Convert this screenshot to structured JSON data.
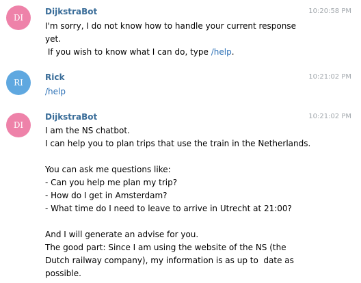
{
  "messages": [
    {
      "avatar": "DI",
      "avatar_color": "#ee82a9",
      "sender": "DijkstraBot",
      "sender_color": "#3a6d99",
      "time": "10:20:58 PM",
      "lines": [
        "I'm sorry, I do not know how to handle your current response",
        "yet."
      ],
      "help_line_prefix": " If you wish to know what I can do, type ",
      "help_link": "/help",
      "help_line_suffix": "."
    },
    {
      "avatar": "RI",
      "avatar_color": "#5fa8e0",
      "sender": "Rick",
      "sender_color": "#3a6d99",
      "time": "10:21:02 PM",
      "link_text": "/help"
    },
    {
      "avatar": "DI",
      "avatar_color": "#ee82a9",
      "sender": "DijkstraBot",
      "sender_color": "#3a6d99",
      "time": "10:21:02 PM",
      "lines": [
        "I am the NS chatbot.",
        "I can help you to plan trips that use the train in the Netherlands.",
        "",
        "You can ask me questions like:",
        "- Can you help me plan my trip?",
        "- How do I get in Amsterdam?",
        "- What time do I need to leave to arrive in Utrecht at 21:00?",
        "",
        "And I will generate an advise for you.",
        "The good part: Since I am using the website of the NS (the",
        "Dutch railway company), my information is as up to  date as",
        "possible."
      ]
    }
  ]
}
